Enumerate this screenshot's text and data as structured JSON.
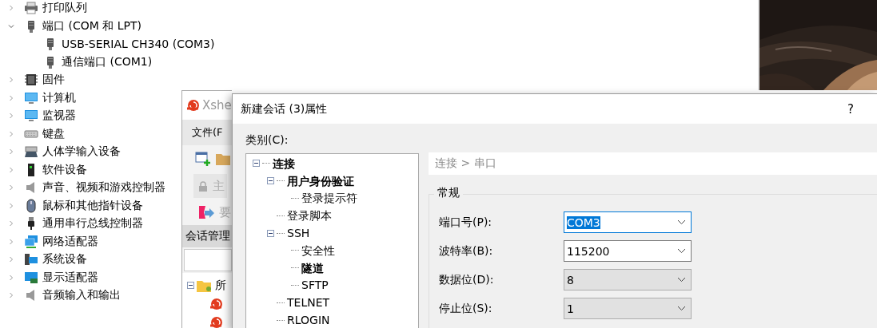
{
  "device_manager": {
    "items": [
      {
        "label": "打印队列",
        "expanded": false
      },
      {
        "label": "端口 (COM 和 LPT)",
        "expanded": true,
        "children": [
          {
            "label": "USB-SERIAL CH340 (COM3)"
          },
          {
            "label": "通信端口 (COM1)"
          }
        ]
      },
      {
        "label": "固件",
        "expanded": false
      },
      {
        "label": "计算机",
        "expanded": false
      },
      {
        "label": "监视器",
        "expanded": false
      },
      {
        "label": "键盘",
        "expanded": false
      },
      {
        "label": "人体学输入设备",
        "expanded": false
      },
      {
        "label": "软件设备",
        "expanded": false
      },
      {
        "label": "声音、视频和游戏控制器",
        "expanded": false
      },
      {
        "label": "鼠标和其他指针设备",
        "expanded": false
      },
      {
        "label": "通用串行总线控制器",
        "expanded": false
      },
      {
        "label": "网络适配器",
        "expanded": false
      },
      {
        "label": "系统设备",
        "expanded": false
      },
      {
        "label": "显示适配器",
        "expanded": false
      },
      {
        "label": "音频输入和输出",
        "expanded": false
      }
    ]
  },
  "xshell": {
    "title": "Xshe",
    "menu": "文件(F",
    "address": "主",
    "link": "要",
    "session_manager": {
      "title": "会话管理",
      "root": {
        "label": "所",
        "expanded": true
      },
      "sessions": [
        {
          "kind": "session"
        },
        {
          "kind": "session"
        }
      ]
    }
  },
  "dialog": {
    "title": "新建会话 (3)属性",
    "help": "?",
    "category_label": "类别(C):",
    "tree": [
      {
        "label": "连接",
        "bold": true,
        "expanded": true,
        "children": [
          {
            "label": "用户身份验证",
            "bold": true,
            "expanded": true,
            "children": [
              {
                "label": "登录提示符",
                "bold": false
              }
            ]
          },
          {
            "label": "登录脚本",
            "bold": false
          },
          {
            "label": "SSH",
            "bold": false,
            "expanded": true,
            "children": [
              {
                "label": "安全性",
                "bold": false
              },
              {
                "label": "隧道",
                "bold": true
              },
              {
                "label": "SFTP",
                "bold": false
              }
            ]
          },
          {
            "label": "TELNET",
            "bold": false
          },
          {
            "label": "RLOGIN",
            "bold": false
          }
        ]
      }
    ],
    "breadcrumb": "连接 > 串口",
    "group": "常规",
    "fields": [
      {
        "label": "端口号(P):",
        "value": "COM3",
        "focused": true,
        "disabled": false
      },
      {
        "label": "波特率(B):",
        "value": "115200",
        "focused": false,
        "disabled": false
      },
      {
        "label": "数据位(D):",
        "value": "8",
        "focused": false,
        "disabled": true
      },
      {
        "label": "停止位(S):",
        "value": "1",
        "focused": false,
        "disabled": true
      }
    ]
  }
}
